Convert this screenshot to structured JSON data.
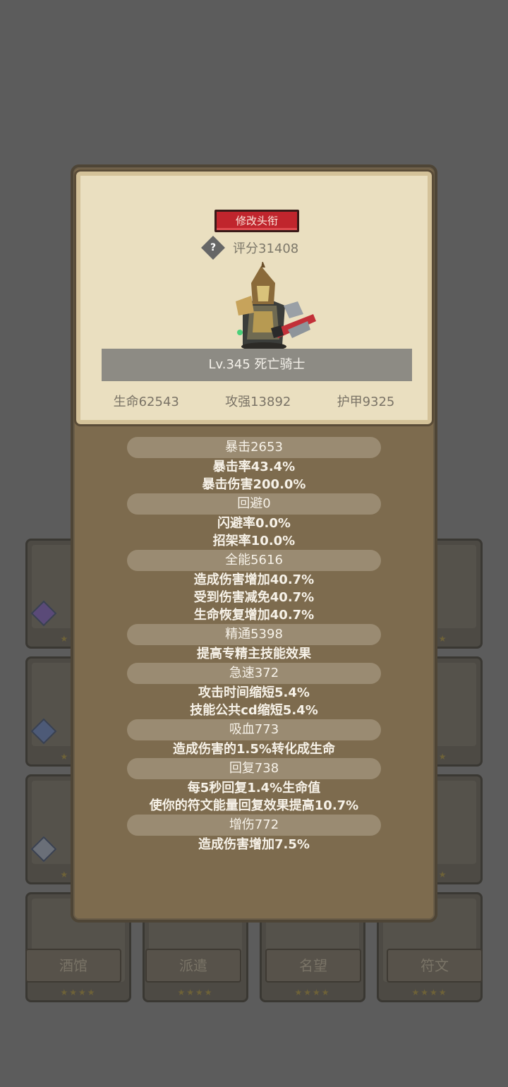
{
  "bottom_tabs": [
    "酒馆",
    "派遣",
    "名望",
    "符文"
  ],
  "bg_stars": "★★★★",
  "panel": {
    "title_button": "修改头衔",
    "help_icon": "?",
    "score": "评分31408",
    "hero_name": "Lv.345 死亡骑士",
    "core_stats": [
      "生命62543",
      "攻强13892",
      "护甲9325"
    ],
    "attributes": [
      {
        "name": "暴击2653",
        "effects": [
          "暴击率43.4%",
          "暴击伤害200.0%"
        ]
      },
      {
        "name": "回避0",
        "effects": [
          "闪避率0.0%",
          "招架率10.0%"
        ]
      },
      {
        "name": "全能5616",
        "effects": [
          "造成伤害增加40.7%",
          "受到伤害减免40.7%",
          "生命恢复增加40.7%"
        ]
      },
      {
        "name": "精通5398",
        "effects": [
          "提高专精主技能效果"
        ]
      },
      {
        "name": "急速372",
        "effects": [
          "攻击时间缩短5.4%",
          "技能公共cd缩短5.4%"
        ]
      },
      {
        "name": "吸血773",
        "effects": [
          "造成伤害的1.5%转化成生命"
        ]
      },
      {
        "name": "回复738",
        "effects": [
          "每5秒回复1.4%生命值",
          "使你的符文能量回复效果提高10.7%"
        ]
      },
      {
        "name": "增伤772",
        "effects": [
          "造成伤害增加7.5%"
        ]
      }
    ]
  }
}
